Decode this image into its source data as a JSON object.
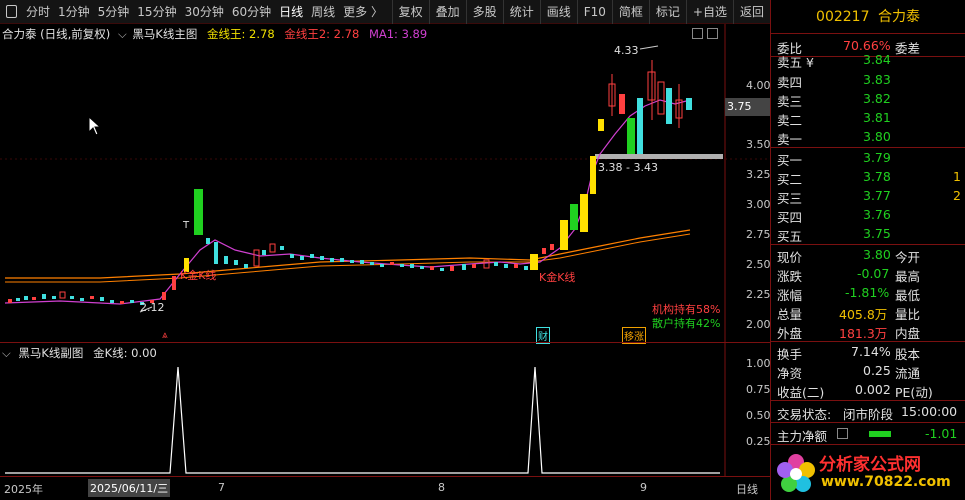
{
  "toolbar": {
    "periods": [
      "分时",
      "1分钟",
      "5分钟",
      "15分钟",
      "30分钟",
      "60分钟",
      "日线",
      "周线",
      "更多 〉"
    ],
    "actions": [
      "复权",
      "叠加",
      "多股",
      "统计",
      "画线",
      "F10",
      "简框",
      "标记",
      "+自选",
      "返回"
    ]
  },
  "main": {
    "stock_label": "合力泰 (日线,前复权)",
    "indicator_name": "黑马K线主图",
    "jx_label": "金线王: 2.78",
    "jx2_label": "金线王2: 2.78",
    "ma_label": "MA1: 3.89",
    "price_axis": [
      "4.00",
      "3.75",
      "3.50",
      "3.25",
      "3.00",
      "2.75",
      "2.50",
      "2.25",
      "2.00"
    ],
    "current_price_box": "3.75",
    "high_annot": "4.33",
    "low_annot": "2.12",
    "range_annot": "3.38 - 3.43",
    "t_mark": "T",
    "k_mark1": "K金K线",
    "k_mark2": "K金K线",
    "inst": "机构持有58%",
    "retail": "散户持有42%",
    "badge_cai": "财",
    "badge_yz": "移涨"
  },
  "sub": {
    "indicator_name": "黑马K线副图",
    "value_label": "金K线: 0.00",
    "axis": [
      "1.00",
      "0.75",
      "0.50",
      "0.25"
    ]
  },
  "dates": {
    "year": "2025年",
    "date": "2025/06/11/三",
    "m7": "7",
    "m8": "8",
    "m9": "9",
    "right": "日线"
  },
  "quote": {
    "code": "002217",
    "name": "合力泰",
    "weibi_label": "委比",
    "weibi_value": "70.66%",
    "weicha_label": "委差",
    "sells": [
      {
        "label": "卖五 ¥",
        "price": "3.84"
      },
      {
        "label": "卖四",
        "price": "3.83"
      },
      {
        "label": "卖三",
        "price": "3.82"
      },
      {
        "label": "卖二",
        "price": "3.81"
      },
      {
        "label": "卖一",
        "price": "3.80"
      }
    ],
    "buys": [
      {
        "label": "买一",
        "price": "3.79",
        "vol": ""
      },
      {
        "label": "买二",
        "price": "3.78",
        "vol": "1"
      },
      {
        "label": "买三",
        "price": "3.77",
        "vol": "2"
      },
      {
        "label": "买四",
        "price": "3.76",
        "vol": ""
      },
      {
        "label": "买五",
        "price": "3.75",
        "vol": ""
      }
    ],
    "stats": [
      {
        "l": "现价",
        "v": "3.80",
        "r": "今开"
      },
      {
        "l": "涨跌",
        "v": "-0.07",
        "r": "最高"
      },
      {
        "l": "涨幅",
        "v": "-1.81%",
        "r": "最低"
      },
      {
        "l": "总量",
        "v": "405.8万",
        "r": "量比"
      },
      {
        "l": "外盘",
        "v": "181.3万",
        "r": "内盘"
      }
    ],
    "stats2": [
      {
        "l": "换手",
        "v": "7.14%",
        "r": "股本"
      },
      {
        "l": "净资",
        "v": "0.25",
        "r": "流通"
      },
      {
        "l": "收益(二)",
        "v": "0.002",
        "r": "PE(动)"
      }
    ],
    "status_label": "交易状态:",
    "status_value": "闭市阶段",
    "status_time": "15:00:00",
    "net_label": "主力净额",
    "net_value": "-1.01",
    "brand": "分析家公式网",
    "brand_url": "www.70822.com"
  },
  "watermark": "www.70822.com 分析家公式网"
}
